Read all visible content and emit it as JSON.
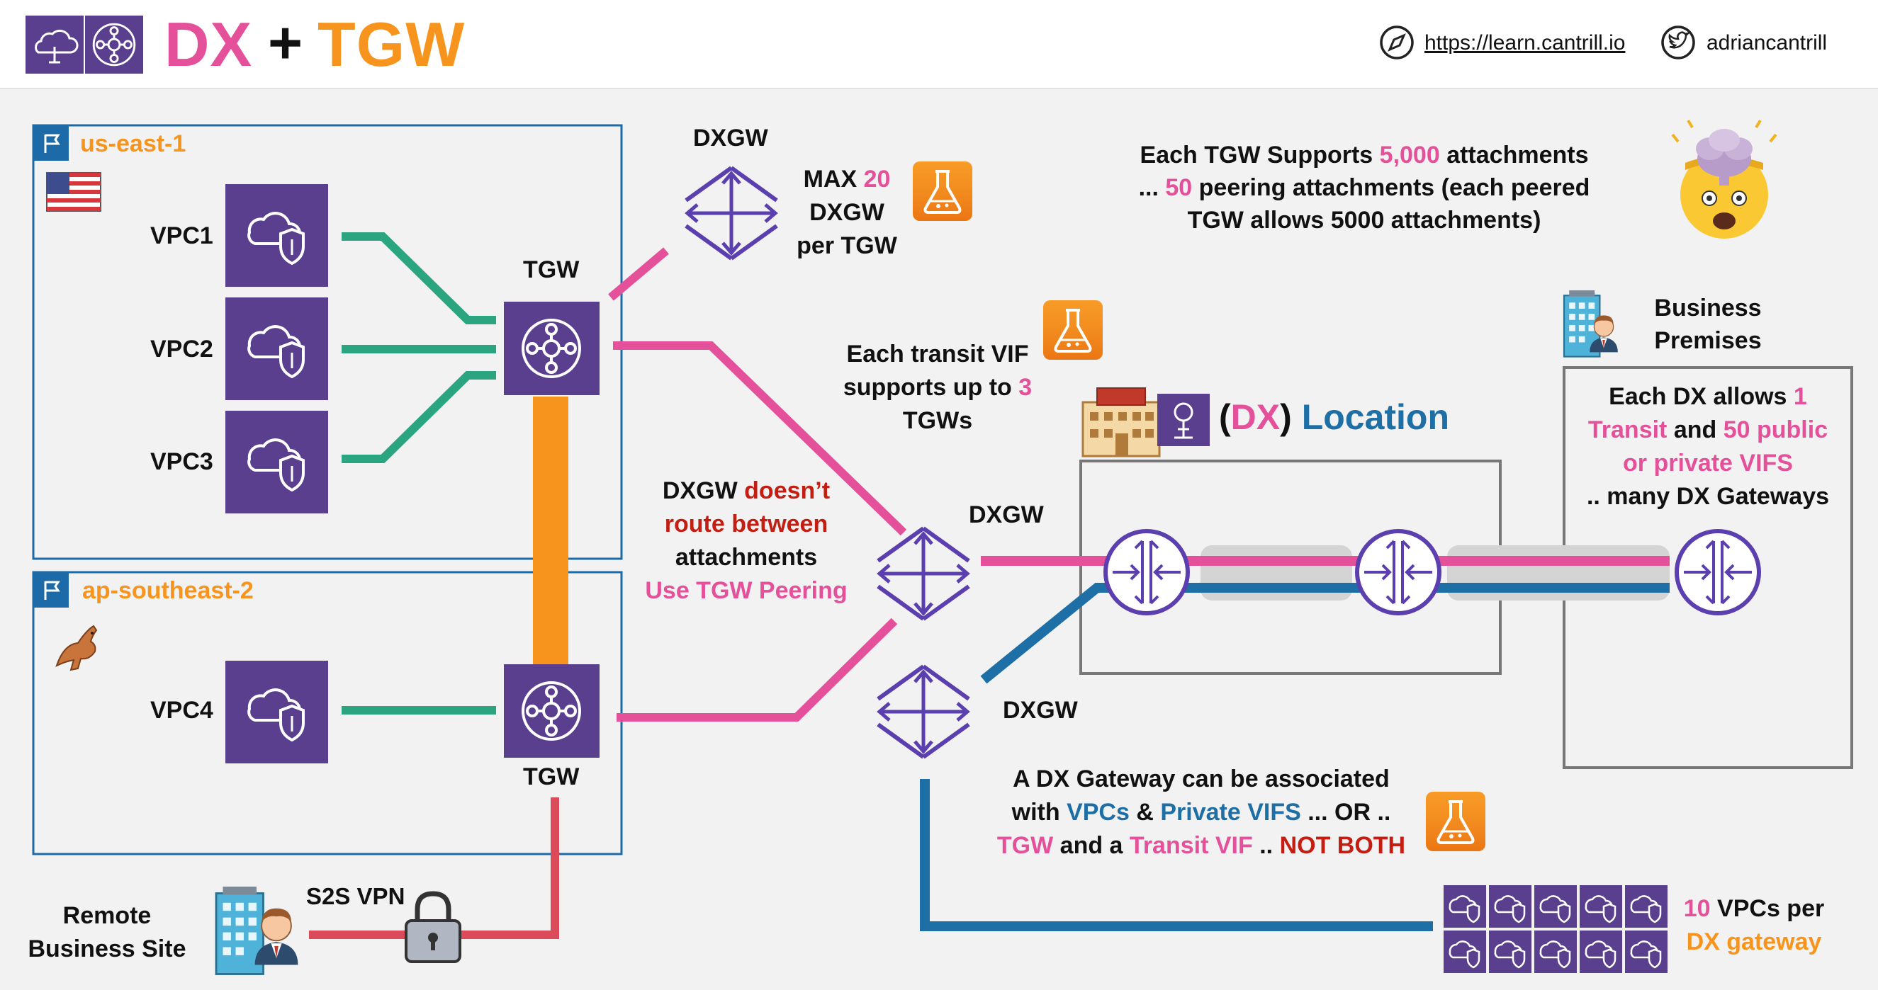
{
  "header": {
    "title_dx": "DX",
    "title_plus": "+",
    "title_tgw": "TGW",
    "website": "https://learn.cantrill.io",
    "twitter": "adriancantrill"
  },
  "regions": {
    "us_east": "us-east-1",
    "ap_southeast": "ap-southeast-2"
  },
  "vpcs": {
    "vpc1": "VPC1",
    "vpc2": "VPC2",
    "vpc3": "VPC3",
    "vpc4": "VPC4"
  },
  "tgw_labels": {
    "top": "TGW",
    "bottom": "TGW"
  },
  "dxgw_labels": {
    "top": "DXGW",
    "middle": "DXGW",
    "lower": "DXGW"
  },
  "max_dxgw": {
    "line1a": "MAX",
    "line1b": "20",
    "line2": "DXGW",
    "line3": "per TGW"
  },
  "tgw_attachments": {
    "line1a": "Each TGW Supports",
    "line1b": "5,000",
    "line1c": "attachments",
    "line2a": "...",
    "line2b": "50",
    "line2c": "peering attachments (each peered",
    "line3": "TGW allows 5000 attachments)"
  },
  "transit_vif": {
    "line1": "Each transit VIF",
    "line2a": "supports up to",
    "line2b": "3",
    "line3": "TGWs"
  },
  "dx_location": {
    "paren_open": "(",
    "dx": "DX",
    "paren_close": ")",
    "location": "Location"
  },
  "business_premises": {
    "line1": "Business",
    "line2": "Premises"
  },
  "dx_allows": {
    "line1a": "Each DX allows",
    "line1b": "1",
    "line2a": "Transit",
    "line2b": "and",
    "line2c": "50 public",
    "line3": "or private VIFS",
    "line4": ".. many DX Gateways"
  },
  "dxgw_routing": {
    "line1a": "DXGW",
    "line1b": "doesn’t",
    "line2": "route between",
    "line3": "attachments",
    "line4": "Use TGW Peering"
  },
  "dx_gateway_assoc": {
    "line1": "A DX Gateway  can be associated",
    "line2a": "with",
    "line2b": "VPCs",
    "line2c": "&",
    "line2d": "Private VIFS",
    "line2e": "... OR ..",
    "line3a": "TGW",
    "line3b": "and a",
    "line3c": "Transit VIF",
    "line3d": "..",
    "line3e": "NOT BOTH"
  },
  "vpcs_per_dxgw": {
    "line1a": "10",
    "line1b": "VPCs per",
    "line2": "DX gateway"
  },
  "remote_site": {
    "line1": "Remote",
    "line2": "Business Site"
  },
  "s2s_vpn": "S2S VPN",
  "colors": {
    "pink": "#e5509a",
    "orange": "#f7941d",
    "purple": "#5b3f8f",
    "teal": "#2aa57f",
    "blue": "#1d6fa5",
    "red_link": "#dc4b59",
    "region_border": "#1c6aa8",
    "dark_red": "#c41e12"
  },
  "icons": [
    "aws-region-icon",
    "direct-connect-icon",
    "compass-icon",
    "twitter-icon",
    "region-flag-icon",
    "us-flag-icon",
    "kangaroo-icon",
    "vpc-icon",
    "transit-gateway-icon",
    "dx-gateway-icon",
    "lab-flask-icon",
    "exploding-head-icon",
    "building-icon",
    "person-icon",
    "dx-router-icon",
    "padlock-icon"
  ]
}
